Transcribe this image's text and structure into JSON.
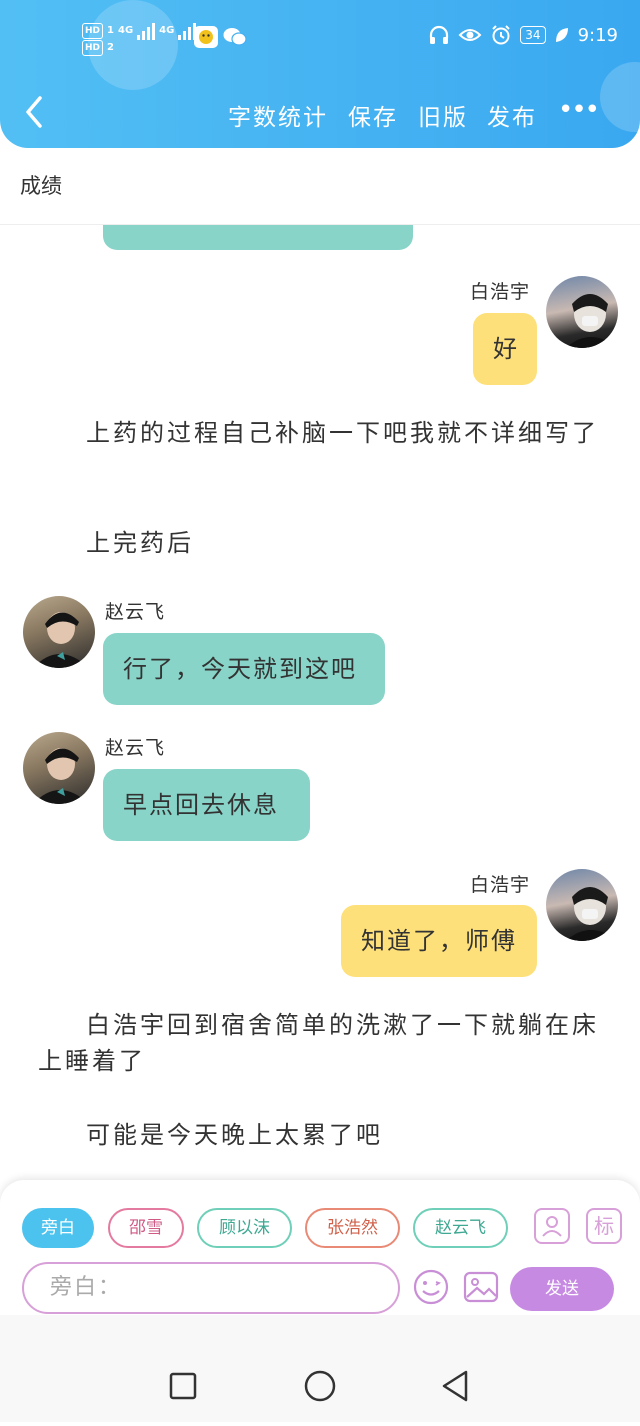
{
  "status_bar": {
    "sim1": "HD",
    "sim1_num": "1",
    "sim2": "HD",
    "sim2_num": "2",
    "net1": "4G",
    "net2": "4G",
    "battery": "34",
    "time": "9:19",
    "icons": [
      "headphones-icon",
      "eye-icon",
      "alarm-icon",
      "leaf-icon"
    ]
  },
  "toolbar": {
    "word_count": "字数统计",
    "save": "保存",
    "old_version": "旧版",
    "publish": "发布",
    "more": "•••"
  },
  "document": {
    "title": "成绩"
  },
  "messages": {
    "m1": {
      "speaker": "白浩宇",
      "text": "好"
    },
    "n1": "上药的过程自己补脑一下吧我就不详细写了",
    "n2": "上完药后",
    "m2": {
      "speaker": "赵云飞",
      "text": "行了，今天就到这吧"
    },
    "m3": {
      "speaker": "赵云飞",
      "text": "早点回去休息"
    },
    "m4": {
      "speaker": "白浩宇",
      "text": "知道了，师傅"
    },
    "n3": "白浩宇回到宿舍简单的洗漱了一下就躺在床上睡着了",
    "n4": "可能是今天晚上太累了吧"
  },
  "composer": {
    "characters": [
      "旁白",
      "邵雪",
      "顾以沫",
      "张浩然",
      "赵云飞"
    ],
    "selected": "旁白",
    "mark_label": "标",
    "input_placeholder": "旁白：",
    "send": "发送"
  },
  "colors": {
    "header": "#3aa8f0",
    "teal_bubble": "#88d4c8",
    "yellow_bubble": "#fee07a",
    "accent_purple": "#c78ae3",
    "chip_narrator": "#4cc3ee"
  }
}
